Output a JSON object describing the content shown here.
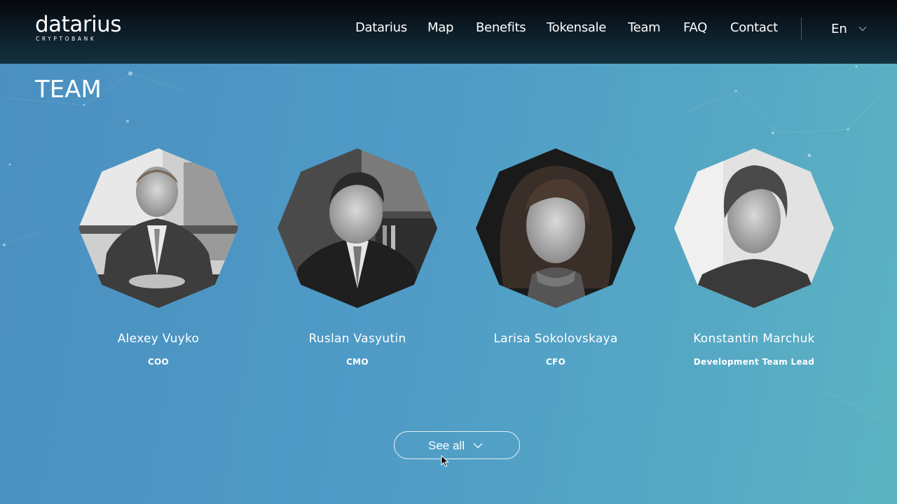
{
  "brand": {
    "name": "datarius",
    "tagline": "CRYPTOBANK"
  },
  "nav": {
    "items": [
      {
        "label": "Datarius"
      },
      {
        "label": "Map"
      },
      {
        "label": "Benefits"
      },
      {
        "label": "Tokensale"
      },
      {
        "label": "Team"
      },
      {
        "label": "FAQ"
      },
      {
        "label": "Contact"
      }
    ],
    "language": "En"
  },
  "section": {
    "title": "TEAM"
  },
  "team": [
    {
      "name": "Alexey Vuyko",
      "role": "COO"
    },
    {
      "name": "Ruslan Vasyutin",
      "role": "CMO"
    },
    {
      "name": "Larisa Sokolovskaya",
      "role": "CFO"
    },
    {
      "name": "Konstantin Marchuk",
      "role": "Development Team Lead"
    }
  ],
  "see_all": {
    "label": "See all"
  },
  "colors": {
    "header_bg": "#0c1b26",
    "section_bg_start": "#4a8fc0",
    "section_bg_end": "#5cb4c2",
    "text": "#ffffff"
  }
}
